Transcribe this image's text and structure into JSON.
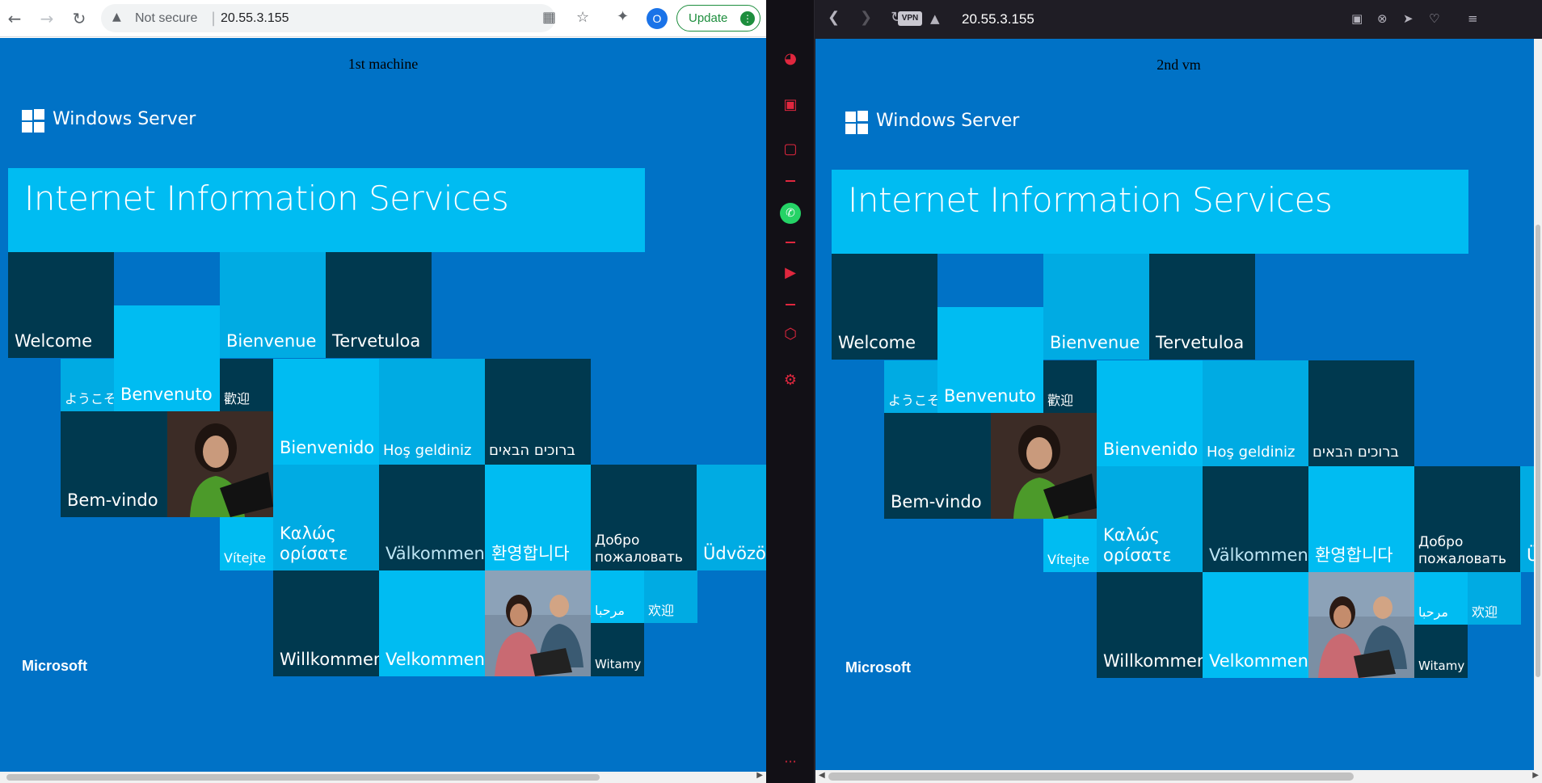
{
  "left_browser": {
    "security_label": "Not secure",
    "url": "20.55.3.155",
    "profile_initial": "O",
    "update_label": "Update",
    "page_heading": "1st machine"
  },
  "right_browser": {
    "vpn_label": "VPN",
    "url": "20.55.3.155",
    "page_heading": "2nd vm",
    "sidebar_more": "···"
  },
  "iis": {
    "logo_text": "Windows Server",
    "banner_title": "Internet Information Services",
    "footer_brand": "Microsoft",
    "tiles": {
      "welcome": "Welcome",
      "bienvenue": "Bienvenue",
      "tervetuloa": "Tervetuloa",
      "youkoso": "ようこそ",
      "benvenuto": "Benvenuto",
      "huanying_trad": "歡迎",
      "bienvenido": "Bienvenido",
      "hos_geldiniz": "Hoş geldiniz",
      "hebrew": "ברוכים הבאים",
      "bem_vindo": "Bem-vindo",
      "vitejte": "Vítejte",
      "kalos": "Καλώς ορίσατε",
      "valkommen": "Välkommen",
      "korean": "환영합니다",
      "russian": "Добро пожаловать",
      "udvozoljuk": "Üdvözöljük",
      "willkommen": "Willkommen",
      "velkommen": "Velkommen",
      "arabic": "مرحبا",
      "huanying_simp": "欢迎",
      "witamy": "Witamy"
    }
  }
}
